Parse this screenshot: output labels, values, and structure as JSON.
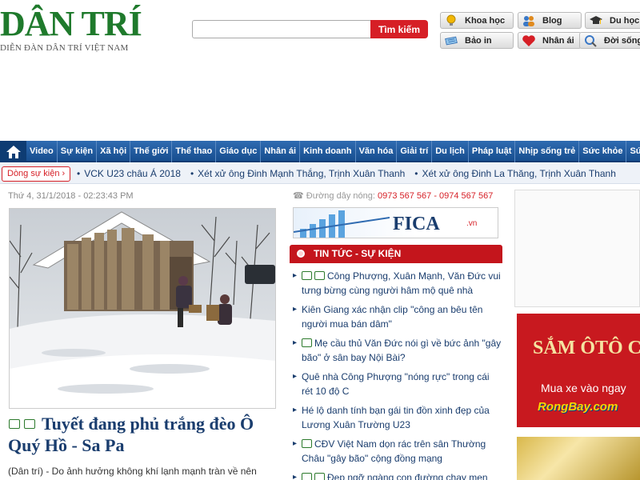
{
  "header": {
    "logo_text": "DÂN TRÍ",
    "logo_subtitle": "DIỄN ĐÀN DÂN TRÍ VIỆT NAM",
    "search": {
      "placeholder": "",
      "button_label": "Tìm kiếm"
    },
    "quick_links": [
      {
        "label": "Khoa học",
        "icon": "lightbulb-icon",
        "color": "#f2b705"
      },
      {
        "label": "Blog",
        "icon": "people-icon",
        "color": "#3a78c7"
      },
      {
        "label": "Du học",
        "icon": "graduation-cap-icon",
        "color": "#333333"
      },
      {
        "label": "Bảo in",
        "icon": "newspaper-icon",
        "color": "#4a9bd6"
      },
      {
        "label": "Nhân ái",
        "icon": "heart-icon",
        "color": "#d61f26"
      },
      {
        "label": "Đời sống",
        "icon": "search-badge-icon",
        "color": "#3a78c7"
      }
    ]
  },
  "nav": {
    "home_icon": "home-icon",
    "items": [
      "Video",
      "Sự kiện",
      "Xã hội",
      "Thế giới",
      "Thể thao",
      "Giáo dục",
      "Nhân ái",
      "Kinh doanh",
      "Văn hóa",
      "Giải trí",
      "Du lịch",
      "Pháp luật",
      "Nhịp sống trẻ",
      "Sức khỏe",
      "Sức mạ"
    ]
  },
  "ticker": {
    "label": "Dòng sự kiện",
    "items": [
      "VCK U23 châu Á 2018",
      "Xét xử ông Đinh Mạnh Thắng, Trịnh Xuân Thanh",
      "Xét xử ông Đinh La Thăng, Trịnh Xuân Thanh"
    ]
  },
  "main_story": {
    "datetime": "Thứ 4, 31/1/2018 - 02:23:43 PM",
    "headline": "Tuyết đang phủ trắng đèo Ô Quý Hồ - Sa Pa",
    "summary": "(Dân trí) - Do ảnh hưởng không khí lạnh mạnh tràn về nên"
  },
  "sidebar_middle": {
    "hotline_label": "Đường dây nóng:",
    "hotline_numbers": "0973 567 567 - 0974 567 567",
    "fica_text": "FICA",
    "fica_suffix": ".vn",
    "news_title": "TIN TỨC - SỰ KIỆN",
    "news": [
      {
        "text": "Công Phượng, Xuân Mạnh, Văn Đức vui tưng bừng cùng người hâm mộ quê nhà",
        "icons": 2
      },
      {
        "text": "Kiên Giang xác nhận clip \"công an bêu tên người mua bán dâm\"",
        "icons": 0
      },
      {
        "text": "Mẹ cầu thủ Văn Đức nói gì về bức ảnh \"gây bão\" ở sân bay Nội Bài?",
        "icons": 1
      },
      {
        "text": "Quê nhà Công Phượng \"nóng rực\" trong cái rét 10 độ C",
        "icons": 0
      },
      {
        "text": "Hé lộ danh tính bạn gái tin đồn xinh đẹp của Lương Xuân Trường U23",
        "icons": 0
      },
      {
        "text": "CĐV Việt Nam dọn rác trên sân Thường Châu \"gây bão\" cộng đồng mạng",
        "icons": 1
      },
      {
        "text": "Đẹp ngỡ ngàng con đường chạy men",
        "icons": 2
      }
    ]
  },
  "ads": {
    "car_title": "SẮM ÔTÔ C",
    "car_sub": "Mua xe vào ngay",
    "car_brand": "RongBay.com"
  },
  "colors": {
    "brand_green": "#1f7a2c",
    "nav_blue": "#1f5ba3",
    "accent_red": "#d61f26"
  }
}
